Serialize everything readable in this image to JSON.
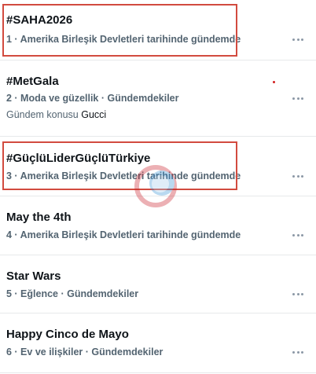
{
  "trends": [
    {
      "title": "#SAHA2026",
      "meta": "1 · Amerika Birleşik Devletleri tarihinde gündemde"
    },
    {
      "title": "#MetGala",
      "meta": "2 · Moda ve güzellik · Gündemdekiler",
      "extra_prefix": "Gündem konusu",
      "extra_topic": "Gucci"
    },
    {
      "title": "#GüçlüLiderGüçlüTürkiye",
      "meta": "3 · Amerika Birleşik Devletleri tarihinde gündemde"
    },
    {
      "title": "May the 4th",
      "meta": "4 · Amerika Birleşik Devletleri tarihinde gündemde"
    },
    {
      "title": "Star Wars",
      "meta": "5 · Eğlence · Gündemdekiler"
    },
    {
      "title": "Happy Cinco de Mayo",
      "meta": "6 · Ev ve ilişkiler · Gündemdekiler"
    }
  ],
  "more_icon": "more-horizontal-icon",
  "highlight_color": "#d24b3f",
  "highlighted_trends": [
    1,
    3
  ]
}
